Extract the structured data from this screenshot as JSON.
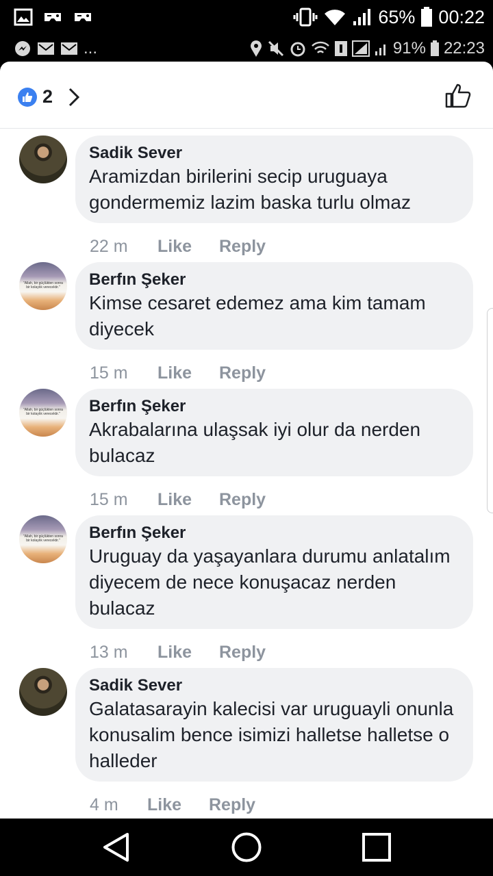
{
  "status_top": {
    "battery": "65%",
    "time": "00:22"
  },
  "status_inner": {
    "more": "...",
    "battery": "91%",
    "time": "22:23"
  },
  "header": {
    "reaction_count": "2"
  },
  "comments": [
    {
      "author": "Sadik Sever",
      "avatar": "profile-photo-man",
      "text": "Aramizdan birilerini secip uruguaya gondermemiz lazim baska turlu olmaz",
      "time": "22 m",
      "like": "Like",
      "reply": "Reply"
    },
    {
      "author": "Berfın Şeker",
      "avatar": "quote-sunset-image",
      "avatar_caption": "\"Allah, bir güçlükten sonra bir kolaylık verecektir.\"",
      "text": "Kimse cesaret edemez ama kim tamam diyecek",
      "time": "15 m",
      "like": "Like",
      "reply": "Reply"
    },
    {
      "author": "Berfın Şeker",
      "avatar": "quote-sunset-image",
      "avatar_caption": "\"Allah, bir güçlükten sonra bir kolaylık verecektir.\"",
      "text": "Akrabalarına ulaşsak iyi olur da nerden bulacaz",
      "time": "15 m",
      "like": "Like",
      "reply": "Reply"
    },
    {
      "author": "Berfın Şeker",
      "avatar": "quote-sunset-image",
      "avatar_caption": "\"Allah, bir güçlükten sonra bir kolaylık verecektir.\"",
      "text": "Uruguay da yaşayanlara durumu anlatalım diyecem de nece konuşacaz nerden bulacaz",
      "time": "13 m",
      "like": "Like",
      "reply": "Reply"
    },
    {
      "author": "Sadik Sever",
      "avatar": "profile-photo-man",
      "text": "Galatasarayin kalecisi var uruguayli onunla konusalim bence isimizi halletse halletse o halleder",
      "time": "4 m",
      "like": "Like",
      "reply": "Reply"
    }
  ],
  "colors": {
    "like_blue": "#3b80f0",
    "bubble_bg": "#f0f1f3",
    "meta_gray": "#8d949e"
  }
}
